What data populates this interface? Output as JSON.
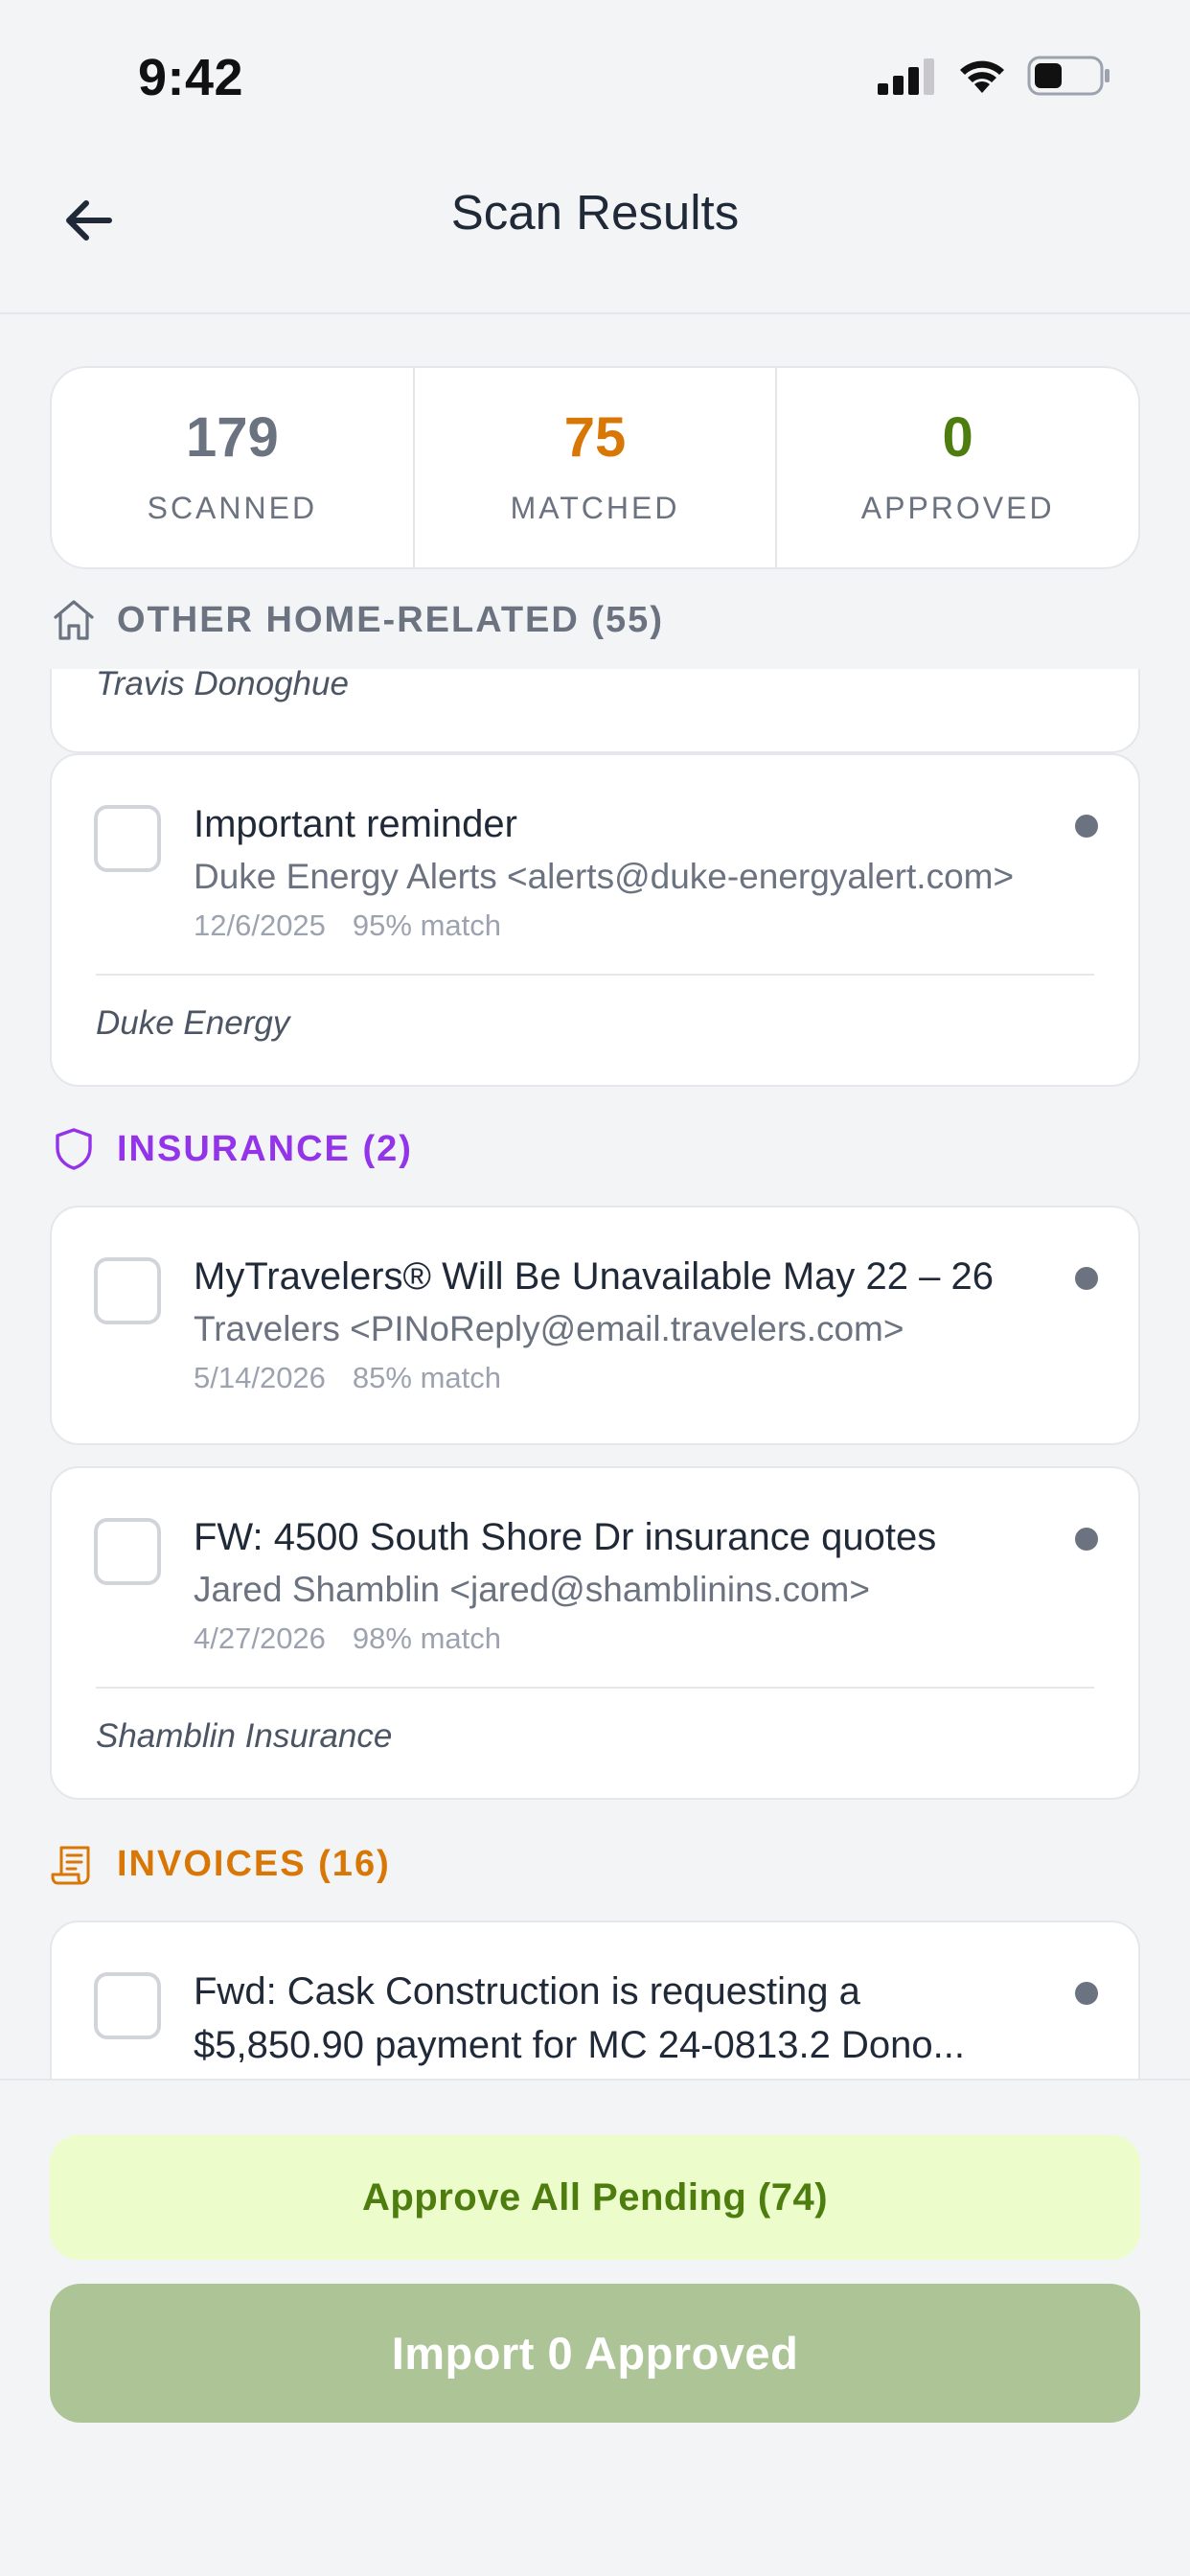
{
  "status_bar": {
    "time": "9:42"
  },
  "header": {
    "title": "Scan Results"
  },
  "stats": [
    {
      "value": "179",
      "label": "SCANNED",
      "color": "#6b7280"
    },
    {
      "value": "75",
      "label": "MATCHED",
      "color": "#d97706"
    },
    {
      "value": "0",
      "label": "APPROVED",
      "color": "#4d7c0f"
    }
  ],
  "sections": {
    "home": {
      "title": "OTHER HOME-RELATED (55)",
      "icon": "home-icon",
      "color": "#6b7280"
    },
    "insurance": {
      "title": "INSURANCE (2)",
      "icon": "shield-icon",
      "color": "#9333ea"
    },
    "invoices": {
      "title": "INVOICES (16)",
      "icon": "receipt-icon",
      "color": "#d97706"
    }
  },
  "partial_card": {
    "footer": "Travis Donoghue"
  },
  "emails": [
    {
      "subject": "Important reminder",
      "sender": "Duke Energy Alerts <alerts@duke-energyalert.com>",
      "date": "12/6/2025",
      "match": "95% match",
      "vendor": "Duke Energy"
    },
    {
      "subject": "MyTravelers® Will Be Unavailable May 22 – 26",
      "sender": "Travelers <PINoReply@email.travelers.com>",
      "date": "5/14/2026",
      "match": "85% match"
    },
    {
      "subject": "FW: 4500 South Shore Dr insurance quotes",
      "sender": "Jared Shamblin <jared@shamblinins.com>",
      "date": "4/27/2026",
      "match": "98% match",
      "vendor": "Shamblin Insurance"
    },
    {
      "subject_line1": "Fwd: Cask Construction is requesting a",
      "subject_line2": "$5,850.90 payment for MC 24-0813.2 Dono..."
    }
  ],
  "actions": {
    "approve_all": "Approve All Pending (74)",
    "import": "Import 0 Approved"
  }
}
